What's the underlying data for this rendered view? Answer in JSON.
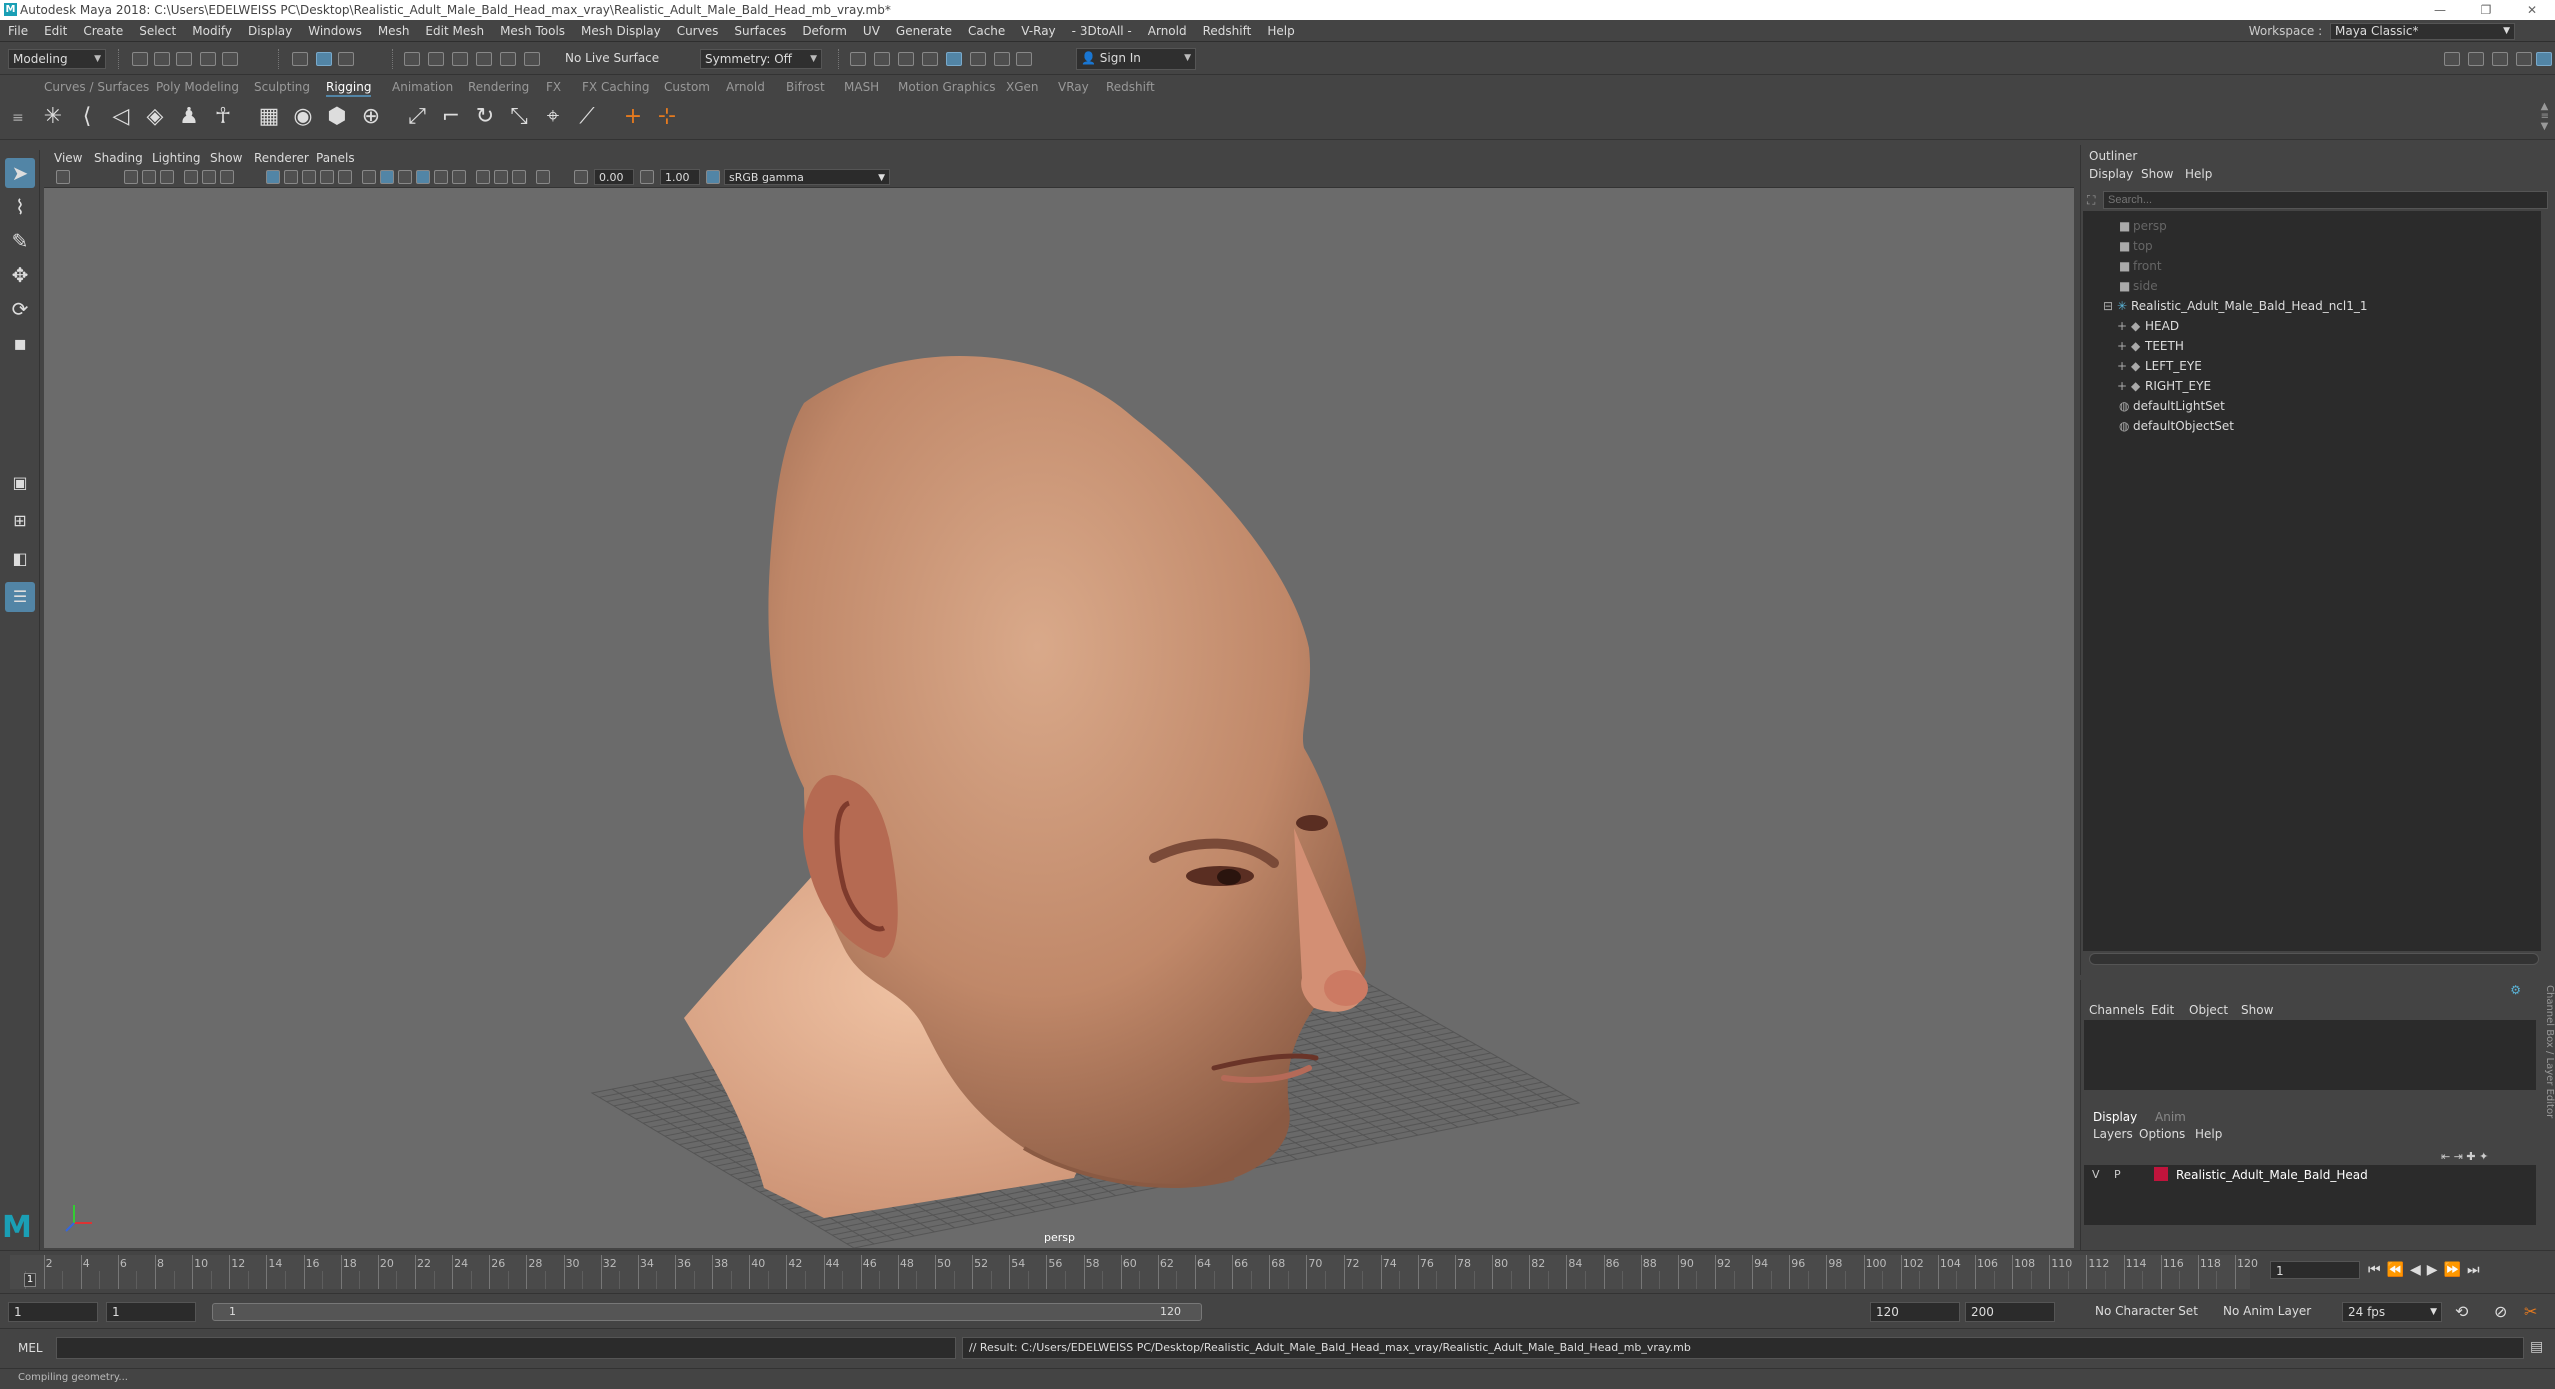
{
  "window": {
    "title": "Autodesk Maya 2018: C:\\Users\\EDELWEISS PC\\Desktop\\Realistic_Adult_Male_Bald_Head_max_vray\\Realistic_Adult_Male_Bald_Head_mb_vray.mb*"
  },
  "menubar": {
    "items": [
      "File",
      "Edit",
      "Create",
      "Select",
      "Modify",
      "Display",
      "Windows",
      "Mesh",
      "Edit Mesh",
      "Mesh Tools",
      "Mesh Display",
      "Curves",
      "Surfaces",
      "Deform",
      "UV",
      "Generate",
      "Cache",
      "V-Ray",
      "- 3DtoAll -",
      "Arnold",
      "Redshift",
      "Help"
    ],
    "workspace_label": "Workspace :",
    "workspace_value": "Maya Classic*"
  },
  "statusline": {
    "mode": "Modeling",
    "live_surface": "No Live Surface",
    "symmetry": "Symmetry: Off",
    "sign_in": "Sign In"
  },
  "shelf": {
    "tabs": [
      "Curves / Surfaces",
      "Poly Modeling",
      "Sculpting",
      "Rigging",
      "Animation",
      "Rendering",
      "FX",
      "FX Caching",
      "Custom",
      "Arnold",
      "Bifrost",
      "MASH",
      "Motion Graphics",
      "XGen",
      "VRay",
      "Redshift"
    ],
    "active_tab": "Rigging"
  },
  "viewport": {
    "menu": [
      "View",
      "Shading",
      "Lighting",
      "Show",
      "Renderer",
      "Panels"
    ],
    "exposure": "0.00",
    "gamma": "1.00",
    "color_space": "sRGB gamma",
    "camera": "persp",
    "colors": {
      "background": "#6b6b6b",
      "grid": "#555555"
    }
  },
  "outliner": {
    "title": "Outliner",
    "menu": [
      "Display",
      "Show",
      "Help"
    ],
    "search_placeholder": "Search...",
    "items": [
      {
        "label": "persp",
        "indent": 0,
        "dim": true
      },
      {
        "label": "top",
        "indent": 0,
        "dim": true
      },
      {
        "label": "front",
        "indent": 0,
        "dim": true
      },
      {
        "label": "side",
        "indent": 0,
        "dim": true
      },
      {
        "label": "Realistic_Adult_Male_Bald_Head_ncl1_1",
        "indent": 0,
        "dim": false
      },
      {
        "label": "HEAD",
        "indent": 1,
        "dim": false
      },
      {
        "label": "TEETH",
        "indent": 1,
        "dim": false
      },
      {
        "label": "LEFT_EYE",
        "indent": 1,
        "dim": false
      },
      {
        "label": "RIGHT_EYE",
        "indent": 1,
        "dim": false
      },
      {
        "label": "defaultLightSet",
        "indent": 0,
        "dim": false
      },
      {
        "label": "defaultObjectSet",
        "indent": 0,
        "dim": false
      }
    ]
  },
  "channelbox": {
    "menu": [
      "Channels",
      "Edit",
      "Object",
      "Show"
    ],
    "layer_tabs": [
      "Display",
      "Anim"
    ],
    "layer_menu": [
      "Layers",
      "Options",
      "Help"
    ],
    "layer": {
      "v": "V",
      "p": "P",
      "name": "Realistic_Adult_Male_Bald_Head",
      "color": "#c0143c"
    },
    "side_label": "Channel Box / Layer Editor"
  },
  "timeline": {
    "labels": [
      "2",
      "4",
      "6",
      "8",
      "10",
      "12",
      "14",
      "16",
      "18",
      "20",
      "22",
      "24",
      "26",
      "28",
      "30",
      "32",
      "34",
      "36",
      "38",
      "40",
      "42",
      "44",
      "46",
      "48",
      "50",
      "52",
      "54",
      "56",
      "58",
      "60",
      "62",
      "64",
      "66",
      "68",
      "70",
      "72",
      "74",
      "76",
      "78",
      "80",
      "82",
      "84",
      "86",
      "88",
      "90",
      "92",
      "94",
      "96",
      "98",
      "100",
      "102",
      "104",
      "106",
      "108",
      "110",
      "112",
      "114",
      "116",
      "118",
      "120"
    ],
    "current_frame": "1",
    "first_label": "1"
  },
  "range": {
    "start": "1",
    "playback_start": "1",
    "slider_start": "1",
    "slider_end": "120",
    "end": "120",
    "anim_end": "200",
    "character_set": "No Character Set",
    "anim_layer": "No Anim Layer",
    "fps": "24 fps"
  },
  "cmdline": {
    "lang": "MEL",
    "result": "// Result: C:/Users/EDELWEISS PC/Desktop/Realistic_Adult_Male_Bald_Head_max_vray/Realistic_Adult_Male_Bald_Head_mb_vray.mb"
  },
  "helpline": {
    "text": "Compiling geometry..."
  }
}
